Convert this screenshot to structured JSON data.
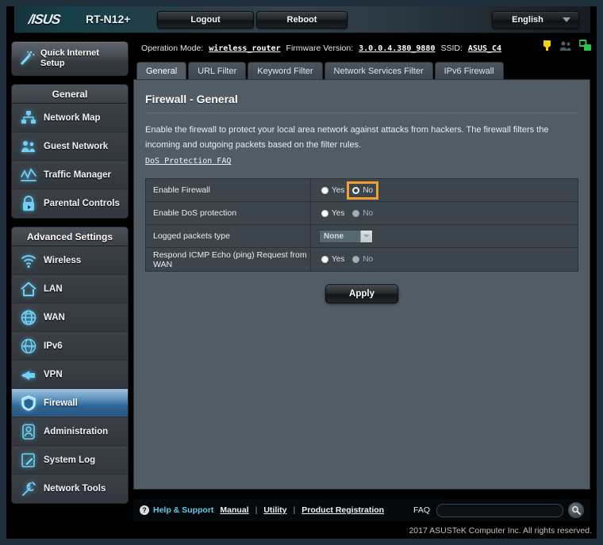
{
  "header": {
    "brand": "/ISUS",
    "model": "RT-N12+",
    "logout_label": "Logout",
    "reboot_label": "Reboot",
    "language": "English"
  },
  "statusbar": {
    "operation_mode_label": "Operation Mode:",
    "operation_mode_value": "wireless_router",
    "firmware_label": "Firmware Version:",
    "firmware_value": "3.0.0.4.380_9880",
    "ssid_label": "SSID:",
    "ssid_value": "ASUS_C4",
    "icons": [
      {
        "name": "wps-key-icon",
        "color": "#f5d300"
      },
      {
        "name": "guest-users-icon",
        "color": "#4e5a61"
      },
      {
        "name": "usb-network-icon",
        "color": "#2fc44a"
      }
    ]
  },
  "sidebar": {
    "quick_setup": {
      "line1": "Quick Internet",
      "line2": "Setup",
      "icon": "magic-wand-icon"
    },
    "general_header": "General",
    "general_items": [
      {
        "label": "Network Map",
        "icon": "network-map-icon"
      },
      {
        "label": "Guest Network",
        "icon": "guest-network-icon"
      },
      {
        "label": "Traffic Manager",
        "icon": "traffic-manager-icon"
      },
      {
        "label": "Parental Controls",
        "icon": "lock-icon"
      }
    ],
    "advanced_header": "Advanced Settings",
    "advanced_items": [
      {
        "label": "Wireless",
        "icon": "wifi-icon",
        "active": false
      },
      {
        "label": "LAN",
        "icon": "house-icon",
        "active": false
      },
      {
        "label": "WAN",
        "icon": "globe-icon",
        "active": false
      },
      {
        "label": "IPv6",
        "icon": "ipv6-globe-icon",
        "active": false
      },
      {
        "label": "VPN",
        "icon": "vpn-key-icon",
        "active": false
      },
      {
        "label": "Firewall",
        "icon": "shield-icon",
        "active": true
      },
      {
        "label": "Administration",
        "icon": "admin-user-icon",
        "active": false
      },
      {
        "label": "System Log",
        "icon": "system-log-icon",
        "active": false
      },
      {
        "label": "Network Tools",
        "icon": "network-tools-icon",
        "active": false
      }
    ]
  },
  "tabs": [
    {
      "label": "General",
      "active": true
    },
    {
      "label": "URL Filter",
      "active": false
    },
    {
      "label": "Keyword Filter",
      "active": false
    },
    {
      "label": "Network Services Filter",
      "active": false
    },
    {
      "label": "IPv6 Firewall",
      "active": false
    }
  ],
  "main": {
    "title": "Firewall - General",
    "description": "Enable the firewall to protect your local area network against attacks from hackers. The firewall filters the incoming and outgoing packets based on the filter rules.",
    "faq_link": "DoS Protection FAQ",
    "rows": [
      {
        "label": "Enable Firewall",
        "type": "radio",
        "options": [
          {
            "label": "Yes",
            "state": "on",
            "focused": false
          },
          {
            "label": "No",
            "state": "off",
            "focused": true
          }
        ]
      },
      {
        "label": "Enable DoS protection",
        "type": "radio",
        "options": [
          {
            "label": "Yes",
            "state": "on",
            "focused": false
          },
          {
            "label": "No",
            "state": "dim",
            "focused": false
          }
        ]
      },
      {
        "label": "Logged packets type",
        "type": "select",
        "value": "None"
      },
      {
        "label": "Respond ICMP Echo (ping) Request from WAN",
        "type": "radio",
        "options": [
          {
            "label": "Yes",
            "state": "on",
            "focused": false
          },
          {
            "label": "No",
            "state": "dim",
            "focused": false
          }
        ]
      }
    ],
    "apply_label": "Apply"
  },
  "footer": {
    "help_icon": "question-mark-icon",
    "help_label": "Help & Support",
    "manual_label": "Manual",
    "utility_label": "Utility",
    "product_registration_label": "Product Registration",
    "separator": "|",
    "faq_label": "FAQ",
    "search_value": "",
    "search_placeholder": "",
    "search_icon": "magnifier-icon",
    "copyright": "2017 ASUSTeK Computer Inc. All rights reserved."
  },
  "colors": {
    "accent_focus": "#f0a132",
    "active_nav": "#2f6594",
    "panel_bg": "#525c64",
    "row_bg": "#3c454c",
    "link_cyan": "#63c8e8"
  }
}
